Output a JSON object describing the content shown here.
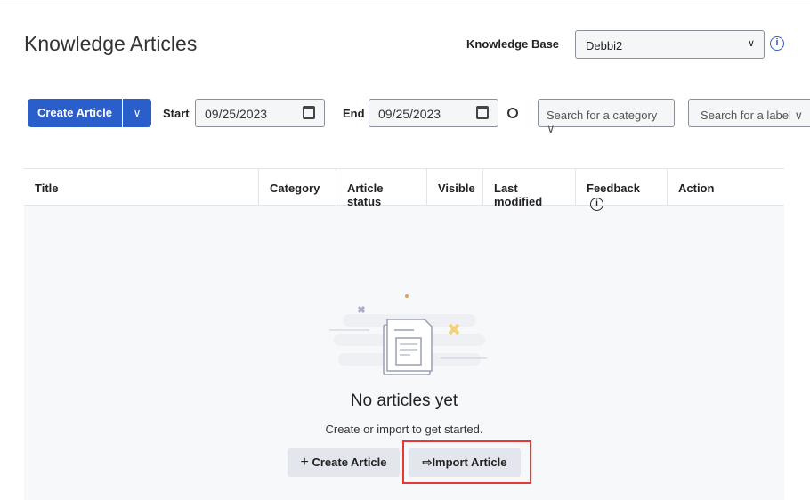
{
  "header": {
    "title": "Knowledge Articles",
    "kb_label": "Knowledge Base",
    "kb_value": "Debbi2"
  },
  "toolbar": {
    "create_label": "Create Article",
    "start_label": "Start",
    "start_value": "09/25/2023",
    "end_label": "End",
    "end_value": "09/25/2023",
    "category_placeholder": "Search for a category",
    "label_placeholder": "Search for a label"
  },
  "table": {
    "columns": [
      "Title",
      "Category",
      "Article status",
      "Visible",
      "Last modified",
      "Feedback",
      "Action"
    ]
  },
  "empty": {
    "title": "No articles yet",
    "subtitle": "Create or import to get started.",
    "create_label": "Create Article",
    "import_label": "Import Article"
  },
  "colors": {
    "primary": "#2a5fcb",
    "highlight": "#e53935"
  }
}
